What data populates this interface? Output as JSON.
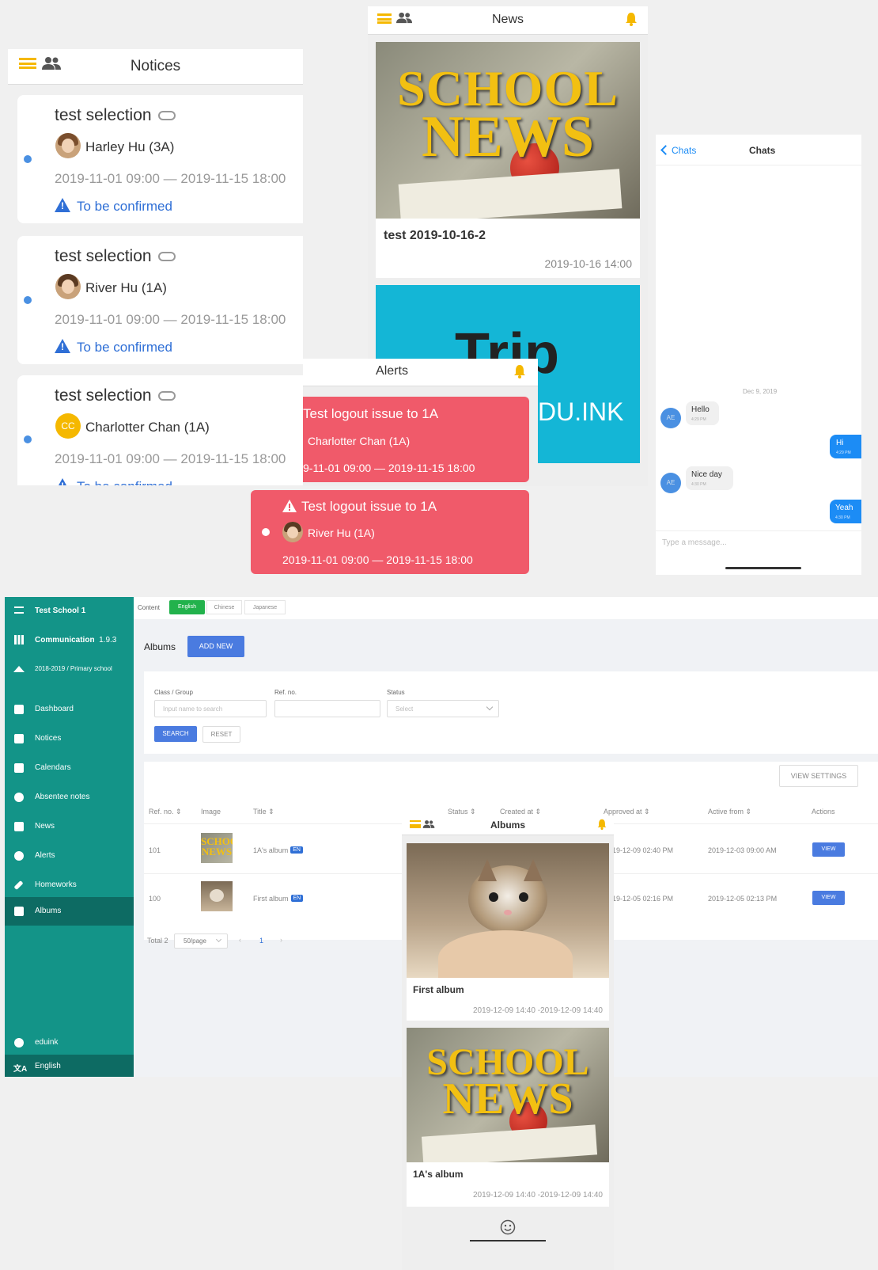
{
  "notices_screen": {
    "title": "Notices",
    "items": [
      {
        "title": "test selection",
        "name": "Harley Hu (3A)",
        "dates": "2019-11-01 09:00 — 2019-11-15 18:00",
        "status": "To be confirmed"
      },
      {
        "title": "test selection",
        "name": "River Hu (1A)",
        "dates": "2019-11-01 09:00 — 2019-11-15 18:00",
        "status": "To be confirmed"
      },
      {
        "title": "test selection",
        "name": "Charlotter Chan (1A)",
        "avatar_initials": "CC",
        "dates": "2019-11-01 09:00 — 2019-11-15 18:00",
        "status": "To be confirmed"
      }
    ]
  },
  "news_screen": {
    "title": "News",
    "image_text_1": "SCHOOL",
    "image_text_2": "NEWS",
    "item_title": "test 2019-10-16-2",
    "item_date": "2019-10-16 14:00",
    "trip_text": "Trip",
    "trip_sub": "DU.INK"
  },
  "alerts_screen": {
    "title": "Alerts",
    "items": [
      {
        "title": "Test logout issue to 1A",
        "name": "Charlotter Chan (1A)",
        "dates": "9-11-01 09:00 — 2019-11-15 18:00"
      },
      {
        "title": "Test logout issue to 1A",
        "name": "River Hu (1A)",
        "dates": "2019-11-01 09:00 — 2019-11-15 18:00"
      }
    ]
  },
  "chats_screen": {
    "back_label": "Chats",
    "title": "Chats",
    "date_divider": "Dec 9, 2019",
    "messages": [
      {
        "side": "left",
        "avatar": "AE",
        "text": "Hello",
        "time": "4:29 PM"
      },
      {
        "side": "right",
        "text": "Hi",
        "time": "4:29 PM"
      },
      {
        "side": "left",
        "avatar": "AE",
        "text": "Nice day",
        "time": "4:30 PM"
      },
      {
        "side": "right",
        "text": "Yeah",
        "time": "4:30 PM"
      }
    ],
    "input_placeholder": "Type a message..."
  },
  "admin": {
    "sidebar": {
      "school": "Test School 1",
      "module": "Communication",
      "version": "1.9.3",
      "year": "2018-2019 / Primary school",
      "items": [
        "Dashboard",
        "Notices",
        "Calendars",
        "Absentee notes",
        "News",
        "Alerts",
        "Homeworks",
        "Albums"
      ],
      "active": "Albums",
      "user": "eduink",
      "language": "English"
    },
    "content_tabs": {
      "label": "Content",
      "tabs": [
        "English",
        "Chinese",
        "Japanese"
      ],
      "active": "English"
    },
    "page_title": "Albums",
    "add_new": "ADD NEW",
    "filters": {
      "class_label": "Class / Group",
      "class_placeholder": "Input name to search",
      "ref_label": "Ref. no.",
      "status_label": "Status",
      "status_placeholder": "Select",
      "search": "SEARCH",
      "reset": "RESET"
    },
    "view_settings": "VIEW SETTINGS",
    "columns": [
      "Ref. no. ⇕",
      "Image",
      "Title ⇕",
      "Status ⇕",
      "Created at ⇕",
      "Approved at ⇕",
      "Active from ⇕",
      "Actions"
    ],
    "rows": [
      {
        "ref": "101",
        "title": "1A's album",
        "lang": "EN",
        "approved": "19-12-09 02:40 PM",
        "active_from": "2019-12-03 09:00 AM",
        "action": "VIEW"
      },
      {
        "ref": "100",
        "title": "First album",
        "lang": "EN",
        "approved": "19-12-05 02:16 PM",
        "active_from": "2019-12-05 02:13 PM",
        "action": "VIEW"
      }
    ],
    "pagination": {
      "total": "Total 2",
      "per_page": "50/page",
      "page": "1"
    }
  },
  "albums_screen": {
    "title": "Albums",
    "items": [
      {
        "title": "First album",
        "dates": "2019-12-09 14:40 -2019-12-09 14:40"
      },
      {
        "title": "1A's album",
        "dates": "2019-12-09 14:40 -2019-12-09 14:40"
      }
    ]
  },
  "colors": {
    "accent_yellow": "#f5b800",
    "teal": "#139488",
    "alert_red": "#f05a6a",
    "link_blue": "#2f6fd6"
  }
}
